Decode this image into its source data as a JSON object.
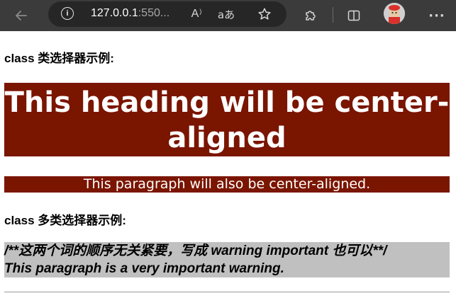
{
  "browser": {
    "url_host": "127.0.0.1",
    "url_rest": ":550...",
    "icons": {
      "back": "back-arrow-icon",
      "info": "info-icon",
      "read_aloud": "read-aloud-icon",
      "translate": "translate-icon",
      "favorite": "star-icon",
      "extensions": "puzzle-icon",
      "split_screen": "split-screen-icon",
      "profile": "avatar",
      "more": "more-icon"
    },
    "read_aloud_glyph": "A",
    "translate_glyph": "aあ",
    "more_glyph": "···",
    "info_glyph": "i"
  },
  "page": {
    "section1_title": "class 类选择器示例:",
    "center_heading": "This heading will be center-aligned",
    "center_paragraph": "This paragraph will also be center-aligned.",
    "section2_title": "class 多类选择器示例:",
    "warning_line1": "/**这两个词的顺序无关紧要，写成 warning important 也可以**/",
    "warning_line2": "This paragraph is a very important warning."
  },
  "colors": {
    "toolbar_bg": "#3b3b3b",
    "address_bg": "#262626",
    "center_bg": "#7a1500",
    "warning_bg": "#c0c0c0"
  }
}
